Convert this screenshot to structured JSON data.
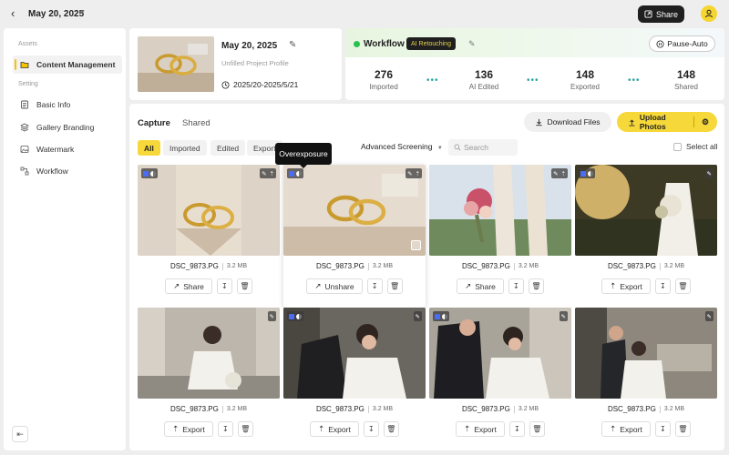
{
  "header": {
    "date": "May 20, 2025",
    "share_label": "Share"
  },
  "sidebar": {
    "sections": [
      {
        "label": "Assets"
      },
      {
        "label": "Setting"
      }
    ],
    "items": [
      {
        "label": "Content Management",
        "icon": "folder-icon",
        "active": true
      },
      {
        "label": "Basic Info",
        "icon": "document-icon"
      },
      {
        "label": "Gallery Branding",
        "icon": "layers-icon"
      },
      {
        "label": "Watermark",
        "icon": "image-icon"
      },
      {
        "label": "Workflow",
        "icon": "workflow-icon"
      }
    ]
  },
  "project": {
    "name": "May 20, 2025",
    "profile": "Unfilled Project Profile",
    "range": "2025/20-2025/5/21"
  },
  "workflow": {
    "title": "Workflow",
    "badge": "AI Retouching",
    "pause_label": "Pause-Auto",
    "stats": [
      {
        "value": "276",
        "label": "Imported"
      },
      {
        "value": "136",
        "label": "AI Edited"
      },
      {
        "value": "148",
        "label": "Exported"
      },
      {
        "value": "148",
        "label": "Shared"
      }
    ]
  },
  "main": {
    "tabs": [
      {
        "label": "Capture"
      },
      {
        "label": "Shared"
      }
    ],
    "download_label": "Download Files",
    "upload_label": "Upload Photos",
    "filters": [
      {
        "label": "All"
      },
      {
        "label": "Imported"
      },
      {
        "label": "Edited"
      },
      {
        "label": "Export"
      },
      {
        "label": "tos"
      }
    ],
    "advanced_label": "Advanced Screening",
    "search_placeholder": "Search",
    "select_all_label": "Select all",
    "tooltip": "Overexposure"
  },
  "photos": [
    {
      "file": "DSC_9873.PG",
      "size": "3.2 MB",
      "action": "Share"
    },
    {
      "file": "DSC_9873.PG",
      "size": "3.2 MB",
      "action": "Unshare"
    },
    {
      "file": "DSC_9873.PG",
      "size": "3.2 MB",
      "action": "Share"
    },
    {
      "file": "DSC_9873.PG",
      "size": "3.2 MB",
      "action": "Export"
    },
    {
      "file": "DSC_9873.PG",
      "size": "3.2 MB",
      "action": "Export"
    },
    {
      "file": "DSC_9873.PG",
      "size": "3.2 MB",
      "action": "Export"
    },
    {
      "file": "DSC_9873.PG",
      "size": "3.2 MB",
      "action": "Export"
    },
    {
      "file": "DSC_9873.PG",
      "size": "3.2 MB",
      "action": "Export"
    }
  ],
  "colors": {
    "accent": "#f7d83a",
    "dark": "#1f1f1f",
    "status_green": "#27c24c"
  }
}
